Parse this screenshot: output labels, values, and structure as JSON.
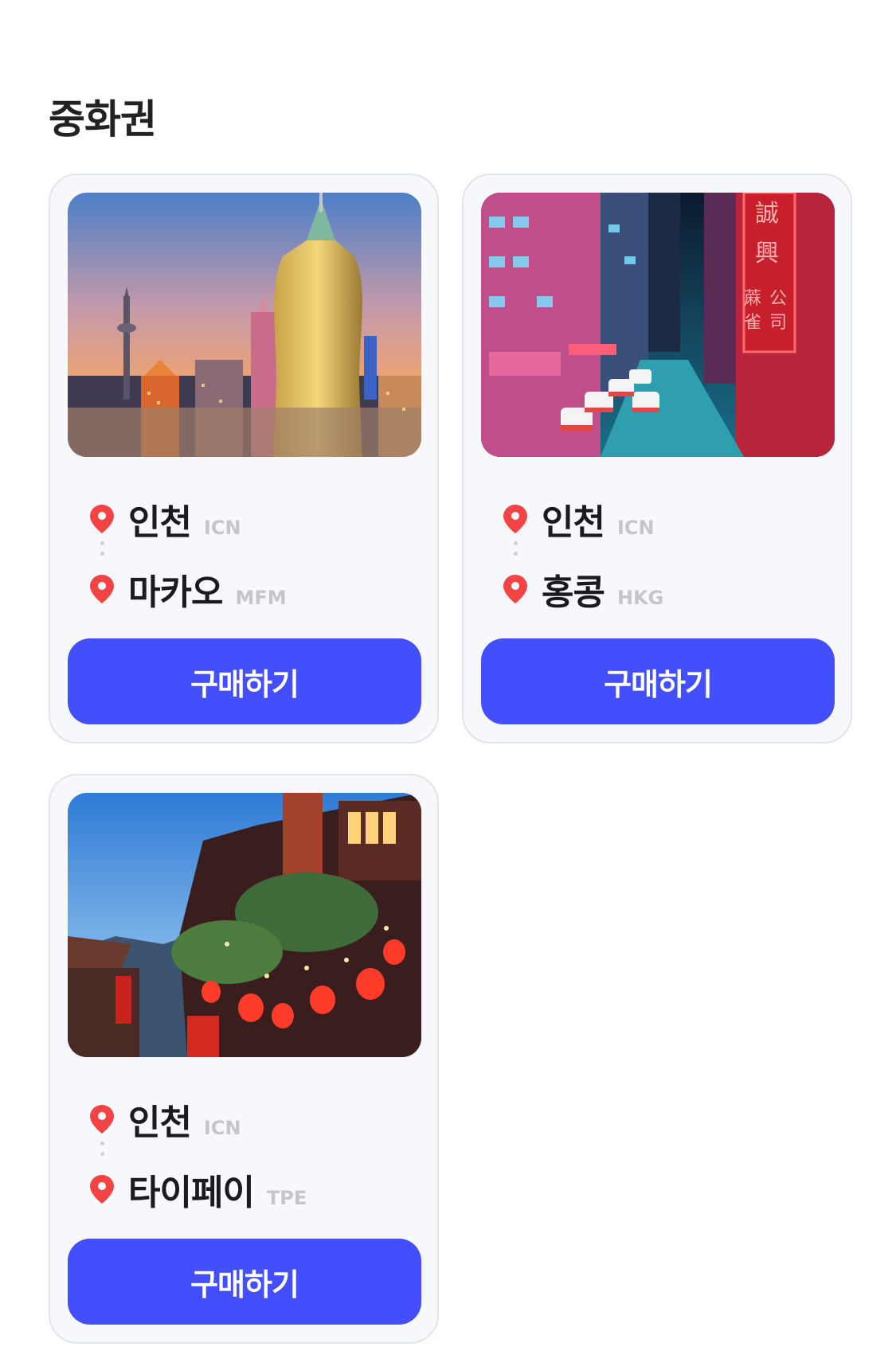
{
  "section": {
    "title": "중화권"
  },
  "cards": [
    {
      "image": "macau-skyline-at-dusk",
      "from": {
        "city": "인천",
        "code": "ICN"
      },
      "to": {
        "city": "마카오",
        "code": "MFM"
      },
      "button_label": "구매하기"
    },
    {
      "image": "hong-kong-neon-street",
      "from": {
        "city": "인천",
        "code": "ICN"
      },
      "to": {
        "city": "홍콩",
        "code": "HKG"
      },
      "button_label": "구매하기"
    },
    {
      "image": "jiufen-lantern-street",
      "from": {
        "city": "인천",
        "code": "ICN"
      },
      "to": {
        "city": "타이페이",
        "code": "TPE"
      },
      "button_label": "구매하기"
    }
  ],
  "colors": {
    "accent": "#434ffd",
    "pin": "#f24444",
    "code_text": "#c4c6cc"
  },
  "icons": {
    "pin": "map-pin-icon"
  }
}
